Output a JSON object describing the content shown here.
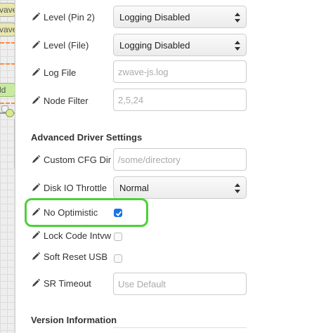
{
  "workspace": {
    "node_top_label": "vave",
    "node_second_label": "vave",
    "node_green_label": "ld"
  },
  "fields": {
    "level_pin2": {
      "label": "Level (Pin 2)",
      "value": "Logging Disabled"
    },
    "level_file": {
      "label": "Level (File)",
      "value": "Logging Disabled"
    },
    "log_file": {
      "label": "Log File",
      "placeholder": "zwave-js.log"
    },
    "node_filter": {
      "label": "Node Filter",
      "placeholder": "2,5,24"
    }
  },
  "advanced": {
    "title": "Advanced Driver Settings",
    "custom_cfg_dir": {
      "label": "Custom CFG Dir",
      "placeholder": "/some/directory"
    },
    "disk_io_throttle": {
      "label": "Disk IO Throttle",
      "value": "Normal"
    },
    "no_optimistic": {
      "label": "No Optimistic",
      "checked": true
    },
    "lock_code_intvw": {
      "label": "Lock Code Intvw",
      "checked": false
    },
    "soft_reset_usb": {
      "label": "Soft Reset USB",
      "checked": false
    },
    "sr_timeout": {
      "label": "SR Timeout",
      "placeholder": "Use Default"
    }
  },
  "version": {
    "title": "Version Information"
  },
  "colors": {
    "highlight": "#4cd137",
    "checkbox_checked": "#1a73e8",
    "wire_orange": "#ff8a3d"
  }
}
